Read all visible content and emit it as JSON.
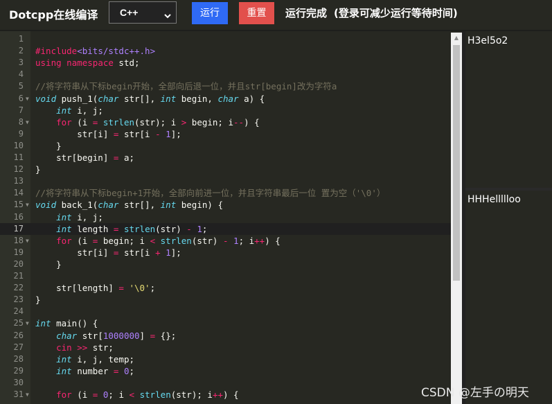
{
  "header": {
    "brand": "Dotcpp在线编译",
    "language_selected": "C++",
    "run_label": "运行",
    "reset_label": "重置",
    "status": "运行完成",
    "status_hint": "(登录可减少运行等待时间)"
  },
  "editor": {
    "active_line": 17,
    "lines": [
      "",
      "#include<bits/stdc++.h>",
      "using namespace std;",
      "",
      "//将字符串从下标begin开始，全部向后退一位，并且str[begin]改为字符a",
      "void push_1(char str[], int begin, char a) {",
      "    int i, j;",
      "    for (i = strlen(str); i > begin; i--) {",
      "        str[i] = str[i - 1];",
      "    }",
      "    str[begin] = a;",
      "}",
      "",
      "//将字符串从下标begin+1开始，全部向前进一位，并且字符串最后一位 置为空（'\\0'）",
      "void back_1(char str[], int begin) {",
      "    int i, j;",
      "    int length = strlen(str) - 1;",
      "    for (i = begin; i < strlen(str) - 1; i++) {",
      "        str[i] = str[i + 1];",
      "    }",
      "",
      "    str[length] = '\\0';",
      "}",
      "",
      "int main() {",
      "    char str[1000000] = {};",
      "    cin >> str;",
      "    int i, j, temp;",
      "    int number = 0;",
      "",
      "    for (i = 0; i < strlen(str); i++) {"
    ]
  },
  "output": {
    "input_text": "H3el5o2",
    "output_text": "HHHellllloo"
  },
  "watermark": "CSDN @左手の明天",
  "icons": {
    "select_arrow": "chevron-down-icon",
    "fold_marker": "fold-arrow-icon",
    "scroll_up": "scroll-up-icon"
  }
}
